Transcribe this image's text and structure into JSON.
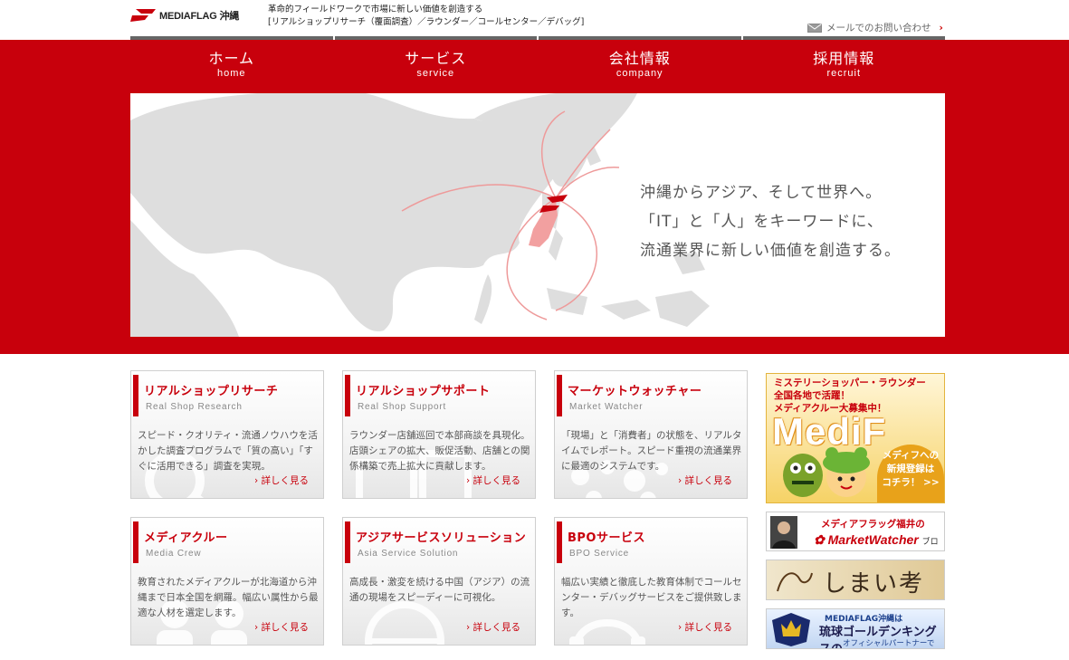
{
  "header": {
    "logo_text": "MEDIAFLAG 沖縄",
    "tagline_line1": "革命的フィールドワークで市場に新しい価値を創造する",
    "tagline_line2": "[リアルショップリサーチ（覆面調査）／ラウンダー／コールセンター／デバッグ]",
    "contact_label": "メールでのお問い合わせ"
  },
  "nav": [
    {
      "jp": "ホーム",
      "en": "home"
    },
    {
      "jp": "サービス",
      "en": "service"
    },
    {
      "jp": "会社情報",
      "en": "company"
    },
    {
      "jp": "採用情報",
      "en": "recruit"
    }
  ],
  "hero": {
    "line1": "沖縄からアジア、そして世界へ。",
    "line2": "「IT」と「人」をキーワードに、",
    "line3": "流通業界に新しい価値を創造する。"
  },
  "cards": [
    {
      "title": "リアルショップリサーチ",
      "sub": "Real Shop Research",
      "desc": "スピード・クオリティ・流通ノウハウを活かした調査プログラムで「質の高い」「すぐに活用できる」調査を実現。",
      "more": "詳しく見る"
    },
    {
      "title": "リアルショップサポート",
      "sub": "Real Shop Support",
      "desc": "ラウンダー店舗巡回で本部商談を具現化。店頭シェアの拡大、販促活動、店舗との関係構築で売上拡大に貢献します。",
      "more": "詳しく見る"
    },
    {
      "title": "マーケットウォッチャー",
      "sub": "Market Watcher",
      "desc": "「現場」と「消費者」の状態を、リアルタイムでレポート。スピード重視の流通業界に最適のシステムです。",
      "more": "詳しく見る"
    },
    {
      "title": "メディアクルー",
      "sub": "Media Crew",
      "desc": "教育されたメディアクルーが北海道から沖縄まで日本全国を網羅。幅広い属性から最適な人材を選定します。",
      "more": "詳しく見る"
    },
    {
      "title": "アジアサービスソリューション",
      "sub": "Asia Service Solution",
      "desc": "高成長・激変を続ける中国（アジア）の流通の現場をスピーディーに可視化。",
      "more": "詳しく見る"
    },
    {
      "title": "BPOサービス",
      "sub": "BPO Service",
      "desc": "幅広い実績と徹底した教育体制でコールセンター・デバッグサービスをご提供致します。",
      "more": "詳しく見る"
    }
  ],
  "banners": {
    "medif_line1": "ミステリーショッパー・ラウンダー",
    "medif_line2": "全国各地で活躍！",
    "medif_line3": "メディアクルー大募集中！",
    "medif_big": "MediF",
    "medif_bubble1": "メディフへの",
    "medif_bubble2": "新規登録は",
    "medif_bubble3": "コチラ！ >>",
    "mw_line1": "メディアフラッグ福井の",
    "mw_line2": "MarketWatcher",
    "mw_line2_suffix": "ブログ",
    "shimai": "しまい考秋",
    "kings_line1": "MEDIAFLAG沖縄は",
    "kings_line2": "琉球ゴールデンキングスの",
    "kings_line3": "オフィシャルパートナーです。"
  },
  "colors": {
    "brand_red": "#c8000c",
    "nav_divider": "#666666"
  }
}
